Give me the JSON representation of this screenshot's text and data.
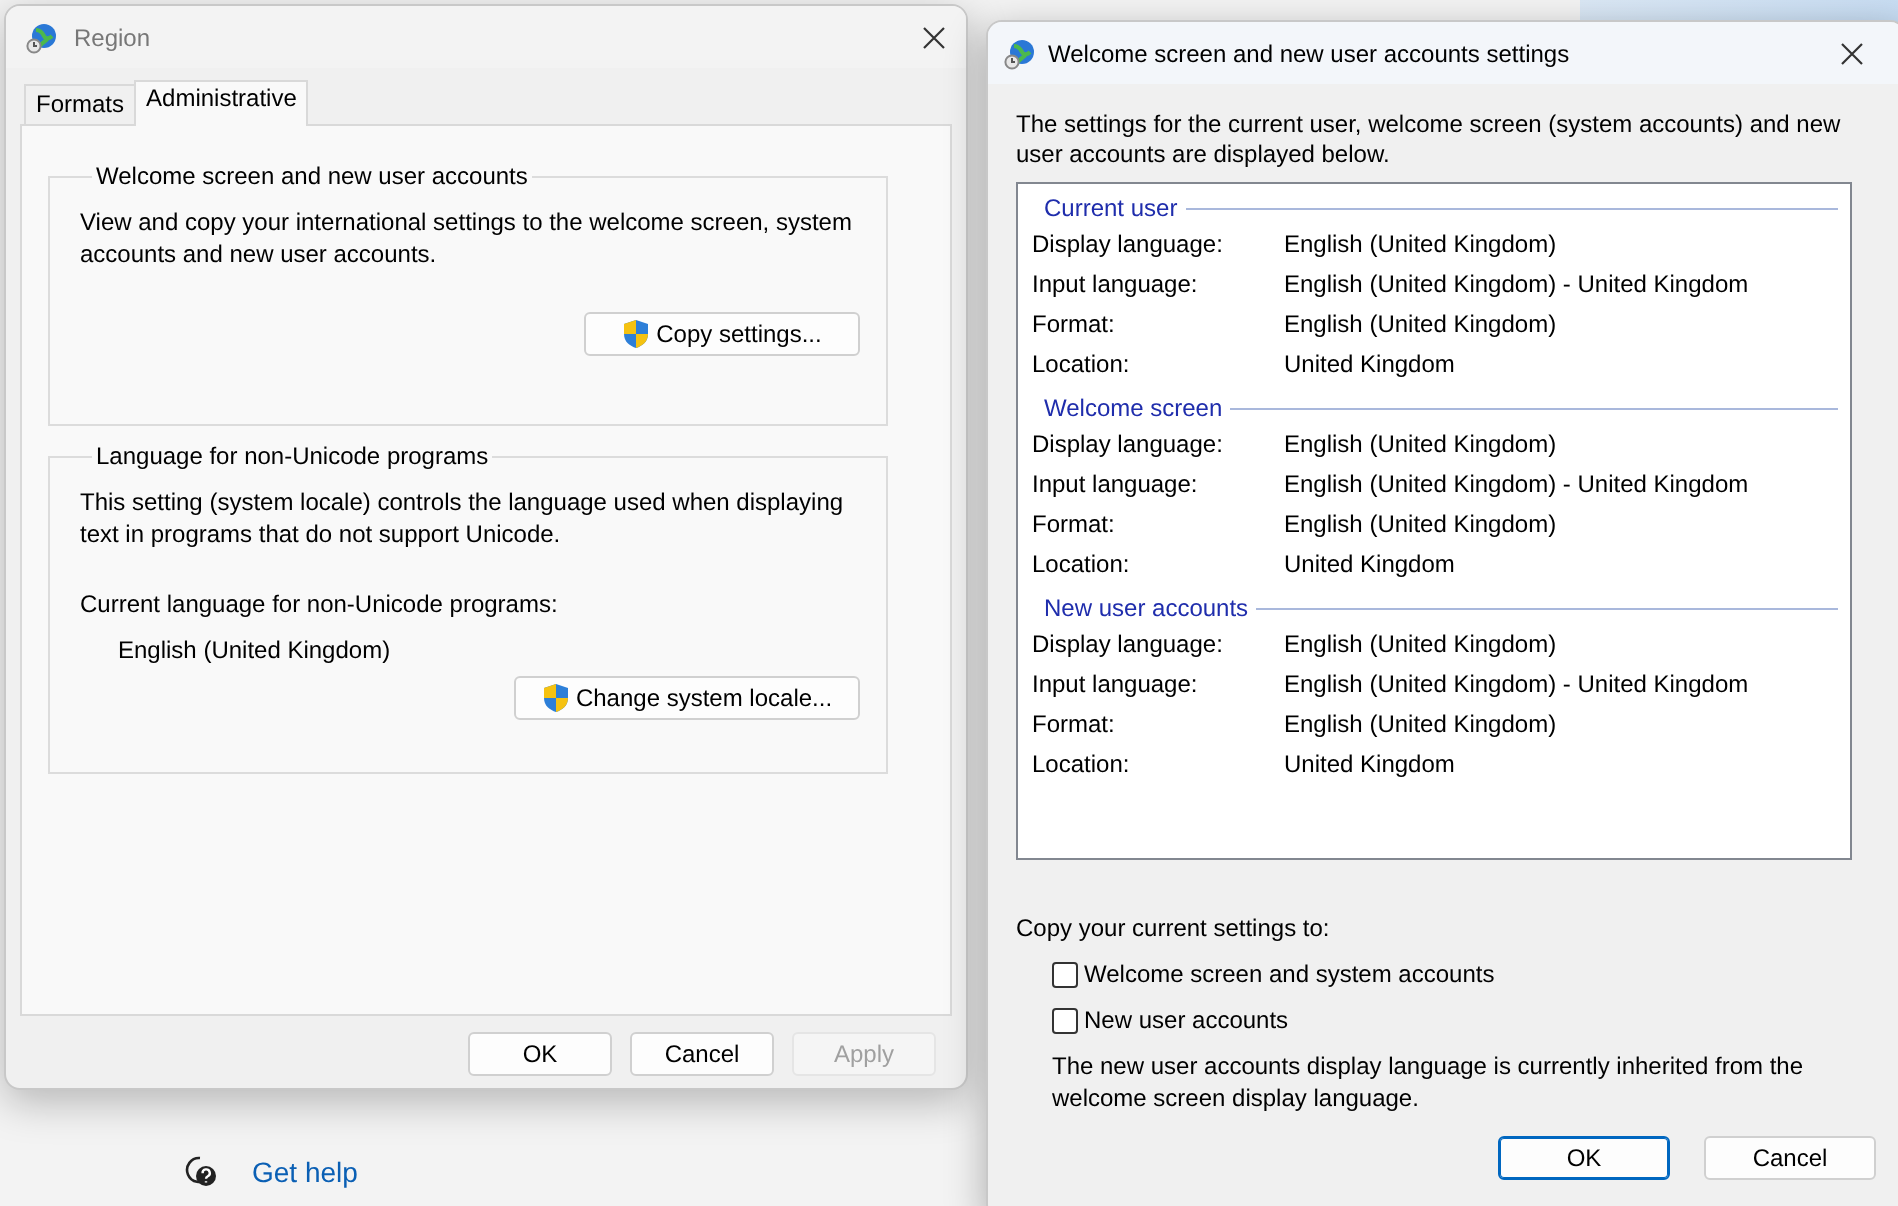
{
  "background": {
    "help_link": "Get help"
  },
  "region_dialog": {
    "title": "Region",
    "tabs": [
      {
        "label": "Formats",
        "selected": false
      },
      {
        "label": "Administrative",
        "selected": true
      }
    ],
    "groups": [
      {
        "title": "Welcome screen and new user accounts",
        "description": "View and copy your international settings to the welcome screen, system accounts and new user accounts.",
        "button": "Copy settings..."
      },
      {
        "title": "Language for non-Unicode programs",
        "description": "This setting (system locale) controls the language used when displaying text in programs that do not support Unicode.",
        "current_label": "Current language for non-Unicode programs:",
        "current_value": "English (United Kingdom)",
        "button": "Change system locale..."
      }
    ],
    "buttons": [
      {
        "label": "OK",
        "disabled": false
      },
      {
        "label": "Cancel",
        "disabled": false
      },
      {
        "label": "Apply",
        "disabled": true
      }
    ]
  },
  "welcome_dialog": {
    "title": "Welcome screen and new user accounts settings",
    "intro": "The settings for the current user, welcome screen (system accounts) and new user accounts are displayed below.",
    "sections": [
      {
        "title": "Current user",
        "rows": [
          {
            "label": "Display language:",
            "value": "English (United Kingdom)"
          },
          {
            "label": "Input language:",
            "value": "English (United Kingdom) - United Kingdom"
          },
          {
            "label": "Format:",
            "value": "English (United Kingdom)"
          },
          {
            "label": "Location:",
            "value": "United Kingdom"
          }
        ]
      },
      {
        "title": "Welcome screen",
        "rows": [
          {
            "label": "Display language:",
            "value": "English (United Kingdom)"
          },
          {
            "label": "Input language:",
            "value": "English (United Kingdom) - United Kingdom"
          },
          {
            "label": "Format:",
            "value": "English (United Kingdom)"
          },
          {
            "label": "Location:",
            "value": "United Kingdom"
          }
        ]
      },
      {
        "title": "New user accounts",
        "rows": [
          {
            "label": "Display language:",
            "value": "English (United Kingdom)"
          },
          {
            "label": "Input language:",
            "value": "English (United Kingdom) - United Kingdom"
          },
          {
            "label": "Format:",
            "value": "English (United Kingdom)"
          },
          {
            "label": "Location:",
            "value": "United Kingdom"
          }
        ]
      }
    ],
    "copy_label": "Copy your current settings to:",
    "checkboxes": [
      {
        "label": "Welcome screen and system accounts",
        "checked": false
      },
      {
        "label": "New user accounts",
        "checked": false
      }
    ],
    "note": "The new user accounts display language is currently inherited from the welcome screen display language.",
    "buttons": [
      {
        "label": "OK",
        "default": true
      },
      {
        "label": "Cancel",
        "default": false
      }
    ]
  }
}
